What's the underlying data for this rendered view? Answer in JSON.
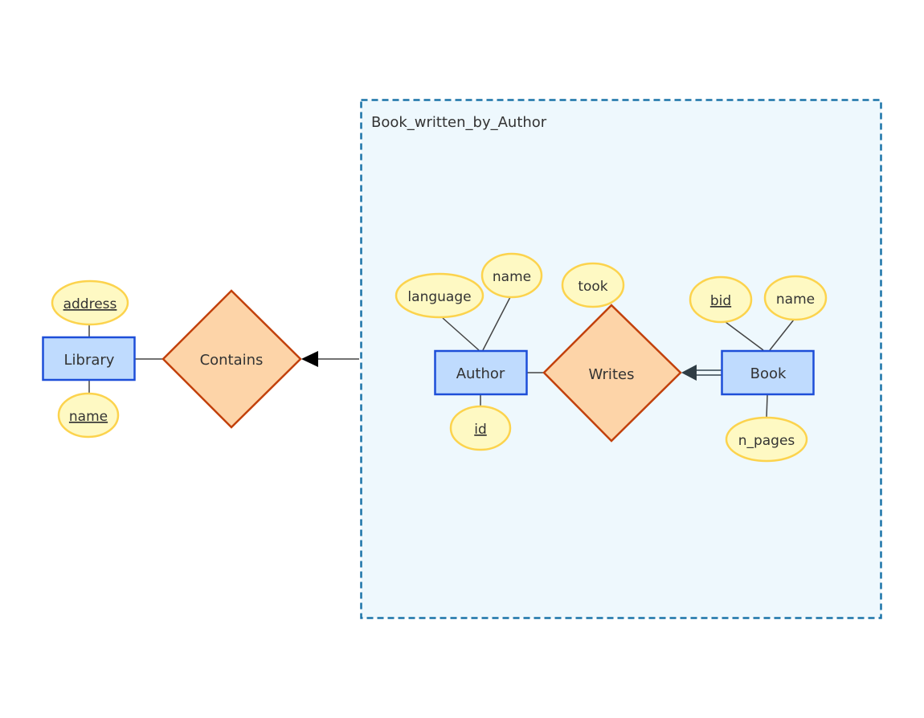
{
  "diagram": {
    "type": "er-diagram",
    "colors": {
      "entity_fill": "#bfdbfe",
      "entity_stroke": "#1d4ed8",
      "relation_fill": "#fdd4a8",
      "relation_stroke": "#c2410c",
      "attribute_fill": "#fef9c3",
      "attribute_stroke": "#fcd34d",
      "group_fill": "#eef8fd",
      "group_stroke": "#1a73a8",
      "line": "#444444"
    },
    "group": {
      "label": "Book_written_by_Author"
    },
    "entities": {
      "library": {
        "label": "Library"
      },
      "author": {
        "label": "Author"
      },
      "book": {
        "label": "Book"
      }
    },
    "relations": {
      "contains": {
        "label": "Contains"
      },
      "writes": {
        "label": "Writes"
      }
    },
    "attributes": {
      "library_address": {
        "label": "address",
        "key": true
      },
      "library_name": {
        "label": "name",
        "key": true
      },
      "author_language": {
        "label": "language",
        "key": false
      },
      "author_name": {
        "label": "name",
        "key": false
      },
      "author_id": {
        "label": "id",
        "key": true
      },
      "writes_took": {
        "label": "took",
        "key": false
      },
      "book_bid": {
        "label": "bid",
        "key": true
      },
      "book_name": {
        "label": "name",
        "key": false
      },
      "book_n_pages": {
        "label": "n_pages",
        "key": false
      }
    },
    "connections": [
      {
        "from": "Library",
        "to": "Contains",
        "style": "line"
      },
      {
        "from": "Book_written_by_Author",
        "to": "Contains",
        "style": "arrow"
      },
      {
        "from": "Author",
        "to": "Writes",
        "style": "line"
      },
      {
        "from": "Book",
        "to": "Writes",
        "style": "double-line-arrow"
      }
    ]
  }
}
